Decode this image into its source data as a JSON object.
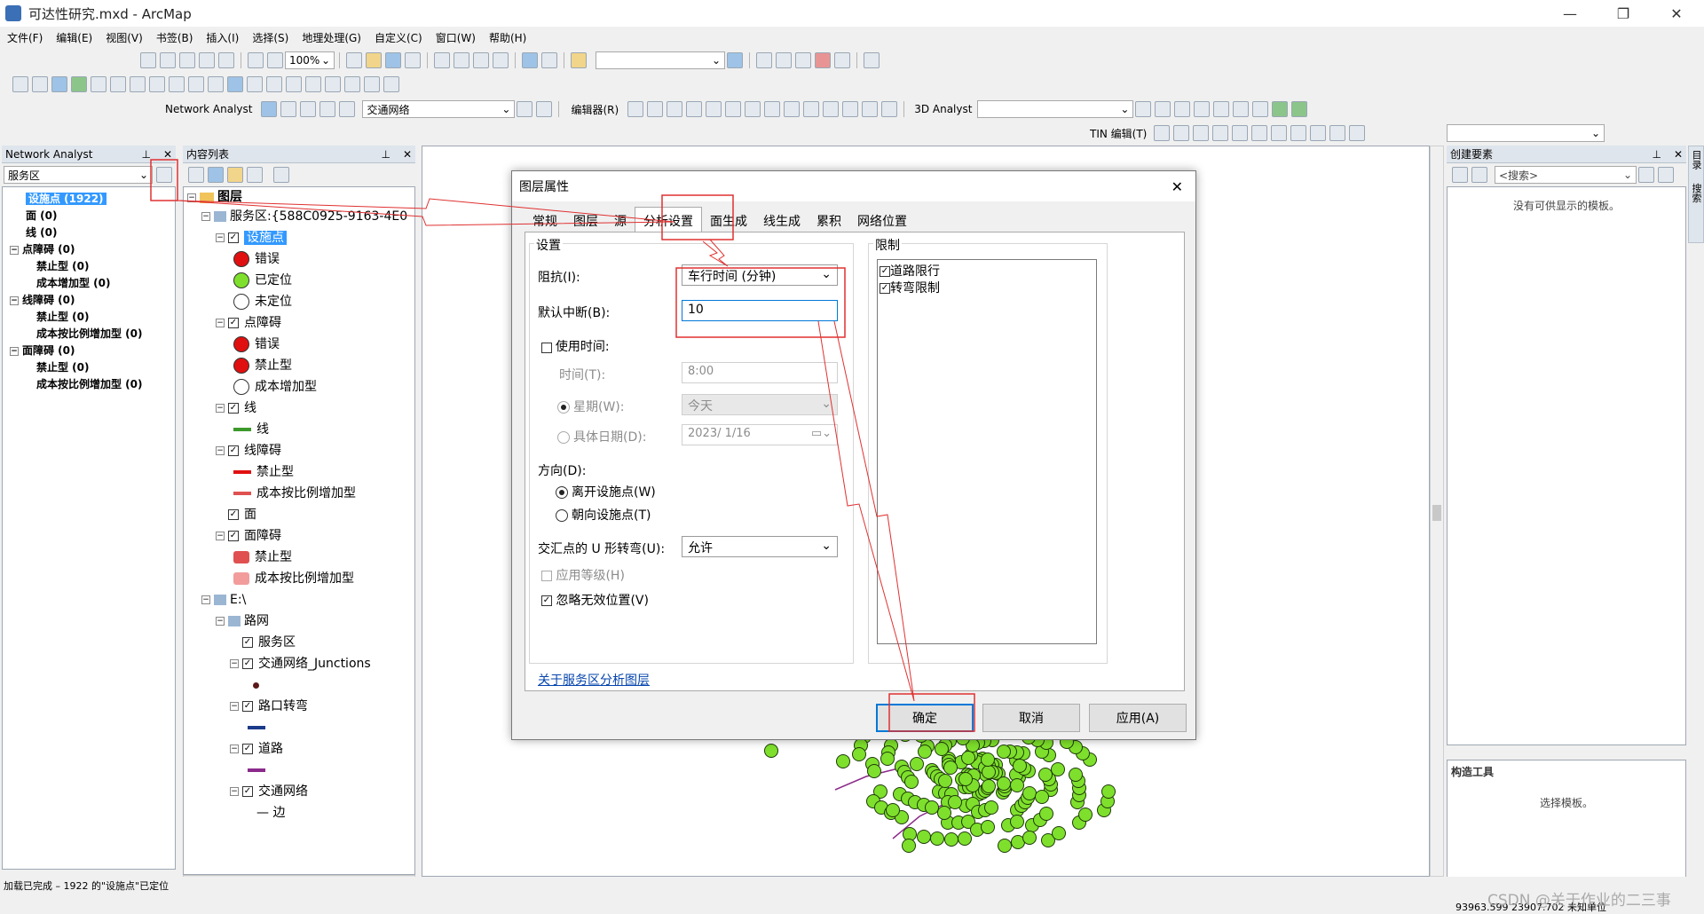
{
  "window": {
    "title": "可达性研究.mxd - ArcMap",
    "min": "—",
    "max": "❐",
    "close": "✕"
  },
  "menu": [
    "文件(F)",
    "编辑(E)",
    "视图(V)",
    "书签(B)",
    "插入(I)",
    "选择(S)",
    "地理处理(G)",
    "自定义(C)",
    "窗口(W)",
    "帮助(H)"
  ],
  "toolbar": {
    "zoom_value": "100%",
    "network_analyst_label": "Network Analyst",
    "network_dataset": "交通网络",
    "editor_label": "编辑器(R)",
    "analyst3d_label": "3D Analyst",
    "tin_label": "TIN 编辑(T)"
  },
  "na_window": {
    "title": "Network Analyst",
    "layer_select": "服务区",
    "items": [
      {
        "label": "设施点 (1922)",
        "indent": 0,
        "selected": true
      },
      {
        "label": "面 (0)",
        "indent": 0
      },
      {
        "label": "线 (0)",
        "indent": 0
      },
      {
        "label": "点障碍 (0)",
        "indent": 0,
        "expander": "⊟"
      },
      {
        "label": "禁止型 (0)",
        "indent": 1
      },
      {
        "label": "成本增加型 (0)",
        "indent": 1
      },
      {
        "label": "线障碍 (0)",
        "indent": 0,
        "expander": "⊟"
      },
      {
        "label": "禁止型 (0)",
        "indent": 1
      },
      {
        "label": "成本按比例增加型 (0)",
        "indent": 1
      },
      {
        "label": "面障碍 (0)",
        "indent": 0,
        "expander": "⊟"
      },
      {
        "label": "禁止型 (0)",
        "indent": 1
      },
      {
        "label": "成本按比例增加型 (0)",
        "indent": 1
      }
    ]
  },
  "toc": {
    "title": "内容列表",
    "root": "图层",
    "items": [
      {
        "label": "服务区:{588C0925-9163-4E0",
        "level": 1,
        "exp": "⊟",
        "chk": false,
        "lyr": true
      },
      {
        "label": "设施点",
        "level": 2,
        "exp": "⊟",
        "chk": true,
        "sel": true
      },
      {
        "label": "错误",
        "level": 3,
        "sym": "red"
      },
      {
        "label": "已定位",
        "level": 3,
        "sym": "green"
      },
      {
        "label": "未定位",
        "level": 3,
        "sym": "q"
      },
      {
        "label": "点障碍",
        "level": 2,
        "exp": "⊟",
        "chk": true
      },
      {
        "label": "错误",
        "level": 3,
        "sym": "qred"
      },
      {
        "label": "禁止型",
        "level": 3,
        "sym": "xred"
      },
      {
        "label": "成本增加型",
        "level": 3,
        "sym": "ring"
      },
      {
        "label": "线",
        "level": 2,
        "exp": "⊟",
        "chk": true
      },
      {
        "label": "线",
        "level": 3,
        "sym": "gline"
      },
      {
        "label": "线障碍",
        "level": 2,
        "exp": "⊟",
        "chk": true
      },
      {
        "label": "禁止型",
        "level": 3,
        "sym": "rline"
      },
      {
        "label": "成本按比例增加型",
        "level": 3,
        "sym": "oline"
      },
      {
        "label": "面",
        "level": 2,
        "chk": true
      },
      {
        "label": "面障碍",
        "level": 2,
        "exp": "⊟",
        "chk": true
      },
      {
        "label": "禁止型",
        "level": 3,
        "sym": "rpoly"
      },
      {
        "label": "成本按比例增加型",
        "level": 3,
        "sym": "hpoly"
      },
      {
        "label": "E:\\",
        "level": 1,
        "exp": "⊟",
        "lyr": true
      },
      {
        "label": "路网",
        "level": 2,
        "exp": "⊟",
        "lyr": true
      },
      {
        "label": "服务区",
        "level": 3,
        "chk": true
      },
      {
        "label": "交通网络_Junctions",
        "level": 3,
        "exp": "⊟",
        "chk": true
      },
      {
        "label": "",
        "level": 4,
        "sym": "bdot"
      },
      {
        "label": "路口转弯",
        "level": 3,
        "exp": "⊟",
        "chk": true
      },
      {
        "label": "",
        "level": 4,
        "sym": "bline"
      },
      {
        "label": "道路",
        "level": 3,
        "exp": "⊟",
        "chk": true
      },
      {
        "label": "",
        "level": 4,
        "sym": "pline"
      },
      {
        "label": "交通网络",
        "level": 3,
        "exp": "⊟",
        "chk": true
      },
      {
        "label": "— 边",
        "level": 4
      }
    ]
  },
  "dialog": {
    "title": "图层属性",
    "tabs": [
      "常规",
      "图层",
      "源",
      "分析设置",
      "面生成",
      "线生成",
      "累积",
      "网络位置"
    ],
    "active_tab": "分析设置",
    "settings_group": "设置",
    "impedance_label": "阻抗(I):",
    "impedance_value": "车行时间 (分钟)",
    "default_breaks_label": "默认中断(B):",
    "default_breaks_value": "10",
    "use_time_label": "使用时间:",
    "time_label": "时间(T):",
    "time_value": "8:00",
    "weekday_label": "星期(W):",
    "weekday_value": "今天",
    "specific_date_label": "具体日期(D):",
    "specific_date_value": "2023/  1/16",
    "direction_label": "方向(D):",
    "direction_away": "离开设施点(W)",
    "direction_toward": "朝向设施点(T)",
    "uturn_label": "交汇点的 U 形转弯(U):",
    "uturn_value": "允许",
    "hierarchy_label": "应用等级(H)",
    "ignore_invalid_label": "忽略无效位置(V)",
    "restrictions_group": "限制",
    "restrictions": [
      "道路限行",
      "转弯限制"
    ],
    "help_link": "关于服务区分析图层",
    "ok": "确定",
    "cancel": "取消",
    "apply": "应用(A)"
  },
  "right_panel": {
    "title": "创建要素",
    "search_placeholder": "<搜索>",
    "no_template": "没有可供显示的模板。",
    "construct_title": "构造工具",
    "construct_hint": "选择模板。",
    "side_tabs": [
      "目录",
      "搜索"
    ]
  },
  "status": {
    "left": "加载已完成 – 1922 的\"设施点\"已定位",
    "coords": "93963.599  23907.702 未知单位",
    "watermark": "CSDN @关于作业的二三事"
  },
  "colors": {
    "accent": "#3399ff",
    "point": "#7ee02c",
    "annotation": "#e03030"
  }
}
